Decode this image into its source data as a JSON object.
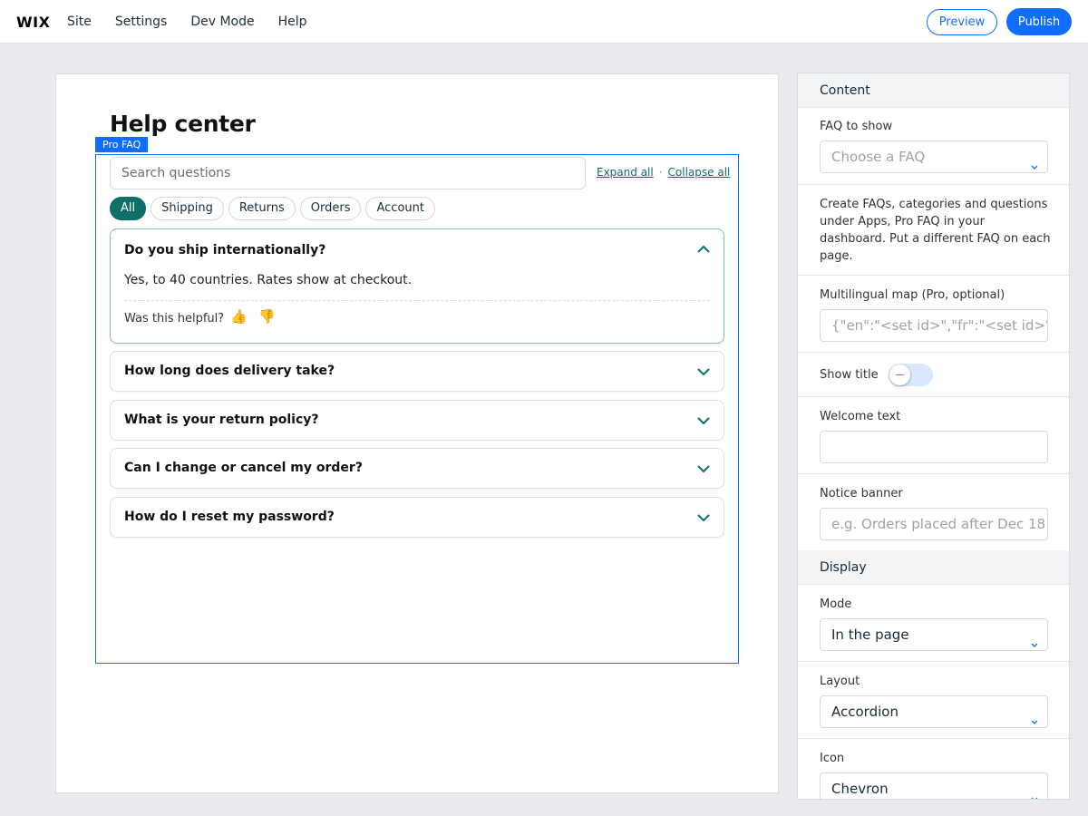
{
  "topbar": {
    "logo": "WIX",
    "menu": [
      "Site",
      "Settings",
      "Dev Mode",
      "Help"
    ],
    "preview_label": "Preview",
    "publish_label": "Publish",
    "accent_color": "#116dff"
  },
  "canvas": {
    "page_title": "Help center",
    "widget_tag": "Pro FAQ",
    "search_placeholder": "Search questions",
    "expand_all": "Expand all",
    "separator": "·",
    "collapse_all": "Collapse all",
    "categories": [
      "All",
      "Shipping",
      "Returns",
      "Orders",
      "Account"
    ],
    "active_category": "All",
    "brand_color": "#0f6e68",
    "open_item": {
      "question": "Do you ship internationally?",
      "answer": "Yes, to 40 countries. Rates show at checkout.",
      "helpful_label": "Was this helpful?",
      "thumbs_up_icon": "👍",
      "thumbs_down_icon": "👎"
    },
    "items": [
      "How long does delivery take?",
      "What is your return policy?",
      "Can I change or cancel my order?",
      "How do I reset my password?"
    ]
  },
  "panel": {
    "content_header": "Content",
    "faq_label": "FAQ to show",
    "faq_placeholder": "Choose a FAQ",
    "description": "Create FAQs, categories and questions under Apps, Pro FAQ in your dashboard. Put a different FAQ on each page.",
    "multilingual_label": "Multilingual map (Pro, optional)",
    "multilingual_placeholder": "{\"en\":\"<set id>\",\"fr\":\"<set id>\"}",
    "show_title_label": "Show title",
    "show_title_on": false,
    "welcome_label": "Welcome text",
    "welcome_value": "",
    "notice_label": "Notice banner",
    "notice_placeholder": "e.g. Orders placed after Dec 18",
    "display_header": "Display",
    "mode_label": "Mode",
    "mode_value": "In the page",
    "layout_label": "Layout",
    "layout_value": "Accordion",
    "icon_label": "Icon",
    "icon_value": "Chevron"
  }
}
